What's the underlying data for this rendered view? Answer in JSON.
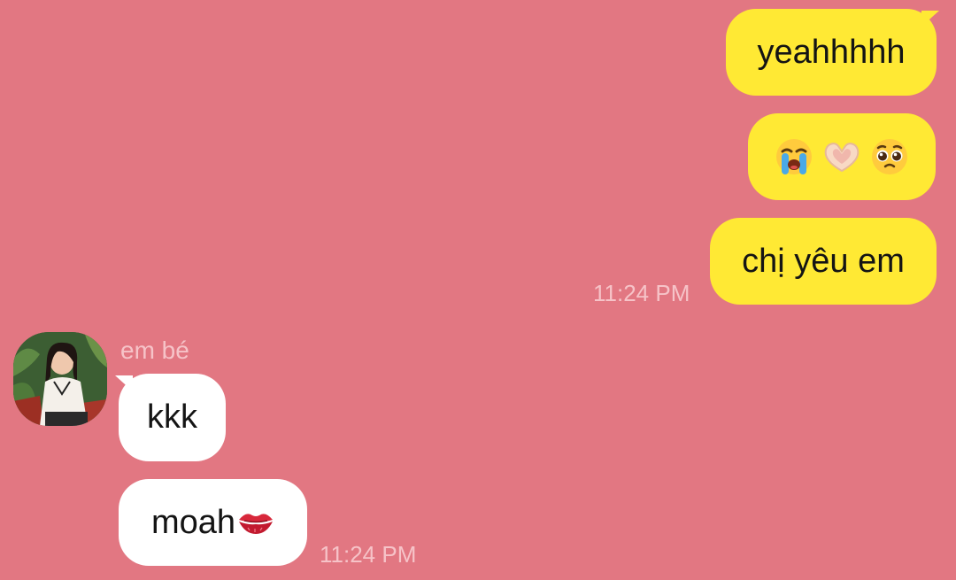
{
  "conversation": {
    "messages": [
      {
        "direction": "outgoing",
        "text": "yeahhhhh"
      },
      {
        "direction": "outgoing",
        "emojis": [
          "loudly-crying-face",
          "heart-hands",
          "pleading-face"
        ]
      },
      {
        "direction": "outgoing",
        "text": "chị yêu em",
        "time": "11:24 PM"
      },
      {
        "direction": "incoming",
        "sender": "em bé",
        "text": "kkk"
      },
      {
        "direction": "incoming",
        "text": "moah",
        "emoji": "kiss-mark",
        "time": "11:24 PM"
      }
    ]
  },
  "colors": {
    "background": "#e27782",
    "outgoing_bubble": "#ffe934",
    "incoming_bubble": "#ffffff",
    "timestamp": "#f6c3c8"
  }
}
